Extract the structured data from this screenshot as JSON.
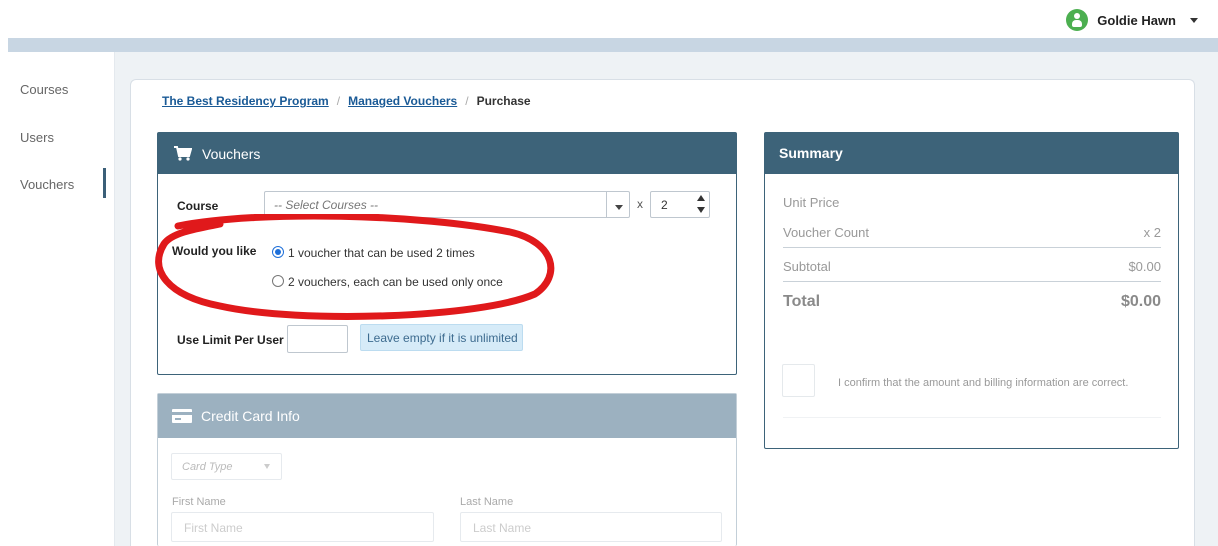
{
  "user": {
    "name": "Goldie Hawn",
    "avatar_icon": "user-avatar-icon"
  },
  "sidebar": {
    "items": [
      {
        "label": "Courses"
      },
      {
        "label": "Users"
      },
      {
        "label": "Vouchers",
        "active": true
      }
    ]
  },
  "breadcrumb": {
    "items": [
      {
        "label": "The Best Residency Program"
      },
      {
        "label": "Managed Vouchers"
      }
    ],
    "current": "Purchase",
    "separator": "/"
  },
  "vouchers": {
    "title": "Vouchers",
    "course_label": "Course",
    "course_placeholder": "-- Select Courses --",
    "times_symbol": "x",
    "quantity": "2",
    "would_you_like_label": "Would you like",
    "options": [
      {
        "label": "1 voucher that can be used 2 times",
        "checked": true
      },
      {
        "label": "2 vouchers, each can be used only once",
        "checked": false
      }
    ],
    "use_limit_label": "Use Limit Per User",
    "use_limit_value": "",
    "use_limit_hint": "Leave empty if it is unlimited"
  },
  "credit_card": {
    "title": "Credit Card Info",
    "card_type_placeholder": "Card Type",
    "first_name_label": "First Name",
    "first_name_placeholder": "First Name",
    "last_name_label": "Last Name",
    "last_name_placeholder": "Last Name"
  },
  "summary": {
    "title": "Summary",
    "unit_price_label": "Unit Price",
    "unit_price_value": "",
    "voucher_count_label": "Voucher Count",
    "voucher_count_value": "x 2",
    "subtotal_label": "Subtotal",
    "subtotal_value": "$0.00",
    "total_label": "Total",
    "total_value": "$0.00",
    "confirm_text": "I confirm that the amount and billing information are correct."
  },
  "colors": {
    "header_dark": "#3d6379",
    "header_light": "#9cb1c0",
    "link": "#1a5a96",
    "annotation": "#e0191b",
    "radio_selected": "#1e6fd9"
  }
}
